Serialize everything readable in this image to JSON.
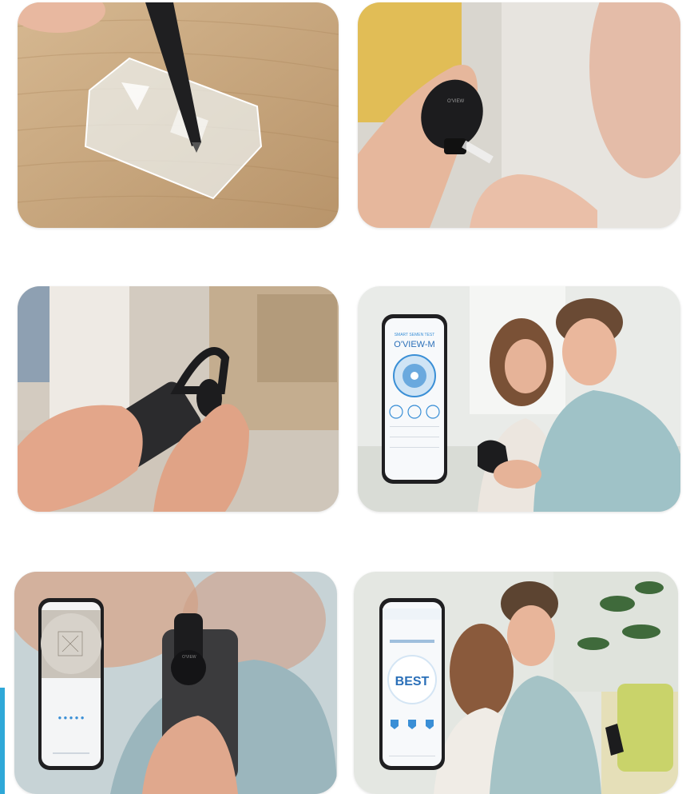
{
  "photos": [
    {
      "id": "p1",
      "subject": "pipette-on-test-strip"
    },
    {
      "id": "p2",
      "subject": "inserting-strip-into-device"
    },
    {
      "id": "p3",
      "subject": "attaching-device-to-phone"
    },
    {
      "id": "p4",
      "subject": "couple-viewing-app"
    },
    {
      "id": "p5",
      "subject": "phone-scanning-strip"
    },
    {
      "id": "p6",
      "subject": "couple-viewing-result"
    }
  ],
  "device": {
    "brand": "O'VIEW"
  },
  "app_screen_home": {
    "header": "SMART SEMEN TEST",
    "logo": "O'VIEW-M"
  },
  "app_screen_scan": {
    "dots": "● ● ● ● ●"
  },
  "app_screen_result": {
    "result": "BEST"
  },
  "colors": {
    "accent": "#2fa8d8",
    "wood": "#c9a57a",
    "device_black": "#1c1c1e",
    "app_blue": "#3a8fd6"
  }
}
